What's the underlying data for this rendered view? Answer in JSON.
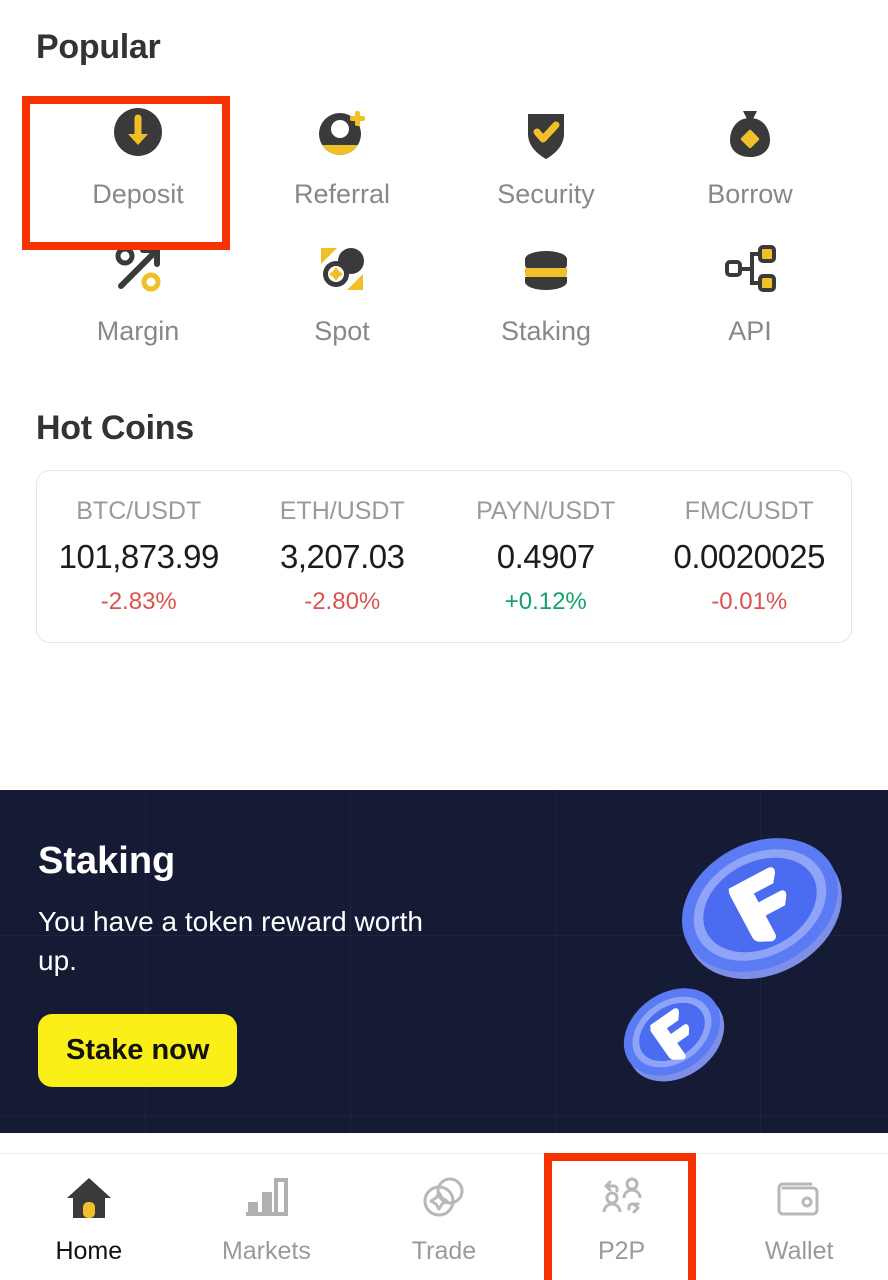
{
  "popular": {
    "title": "Popular",
    "items": [
      {
        "label": "Deposit",
        "icon": "deposit-icon",
        "highlighted": true
      },
      {
        "label": "Referral",
        "icon": "referral-icon",
        "highlighted": false
      },
      {
        "label": "Security",
        "icon": "security-shield-icon",
        "highlighted": false
      },
      {
        "label": "Borrow",
        "icon": "money-bag-icon",
        "highlighted": false
      },
      {
        "label": "Margin",
        "icon": "percent-arrow-icon",
        "highlighted": false
      },
      {
        "label": "Spot",
        "icon": "spot-coins-icon",
        "highlighted": false
      },
      {
        "label": "Staking",
        "icon": "coin-stack-icon",
        "highlighted": false
      },
      {
        "label": "API",
        "icon": "api-nodes-icon",
        "highlighted": false
      }
    ]
  },
  "hot_coins": {
    "title": "Hot Coins",
    "coins": [
      {
        "pair": "BTC/USDT",
        "price": "101,873.99",
        "change": "-2.83%",
        "direction": "down"
      },
      {
        "pair": "ETH/USDT",
        "price": "3,207.03",
        "change": "-2.80%",
        "direction": "down"
      },
      {
        "pair": "PAYN/USDT",
        "price": "0.4907",
        "change": "+0.12%",
        "direction": "up"
      },
      {
        "pair": "FMC/USDT",
        "price": "0.0020025",
        "change": "-0.01%",
        "direction": "down"
      }
    ]
  },
  "banner": {
    "title": "Staking",
    "subtitle": "You have a token reward worth up.",
    "button_label": "Stake now",
    "art": "f-token-coins"
  },
  "bottom_nav": {
    "items": [
      {
        "label": "Home",
        "icon": "home-icon",
        "active": true,
        "highlighted": false
      },
      {
        "label": "Markets",
        "icon": "bar-chart-icon",
        "active": false,
        "highlighted": false
      },
      {
        "label": "Trade",
        "icon": "trade-coins-icon",
        "active": false,
        "highlighted": false
      },
      {
        "label": "P2P",
        "icon": "p2p-exchange-icon",
        "active": false,
        "highlighted": true
      },
      {
        "label": "Wallet",
        "icon": "wallet-icon",
        "active": false,
        "highlighted": false
      }
    ]
  },
  "colors": {
    "accent_yellow": "#F0C028",
    "dark": "#3A3A3A",
    "banner_bg": "#151a35",
    "button_yellow": "#FAEF17",
    "highlight_red": "#F63300",
    "up_green": "#15a06a",
    "down_red": "#d9534f"
  }
}
